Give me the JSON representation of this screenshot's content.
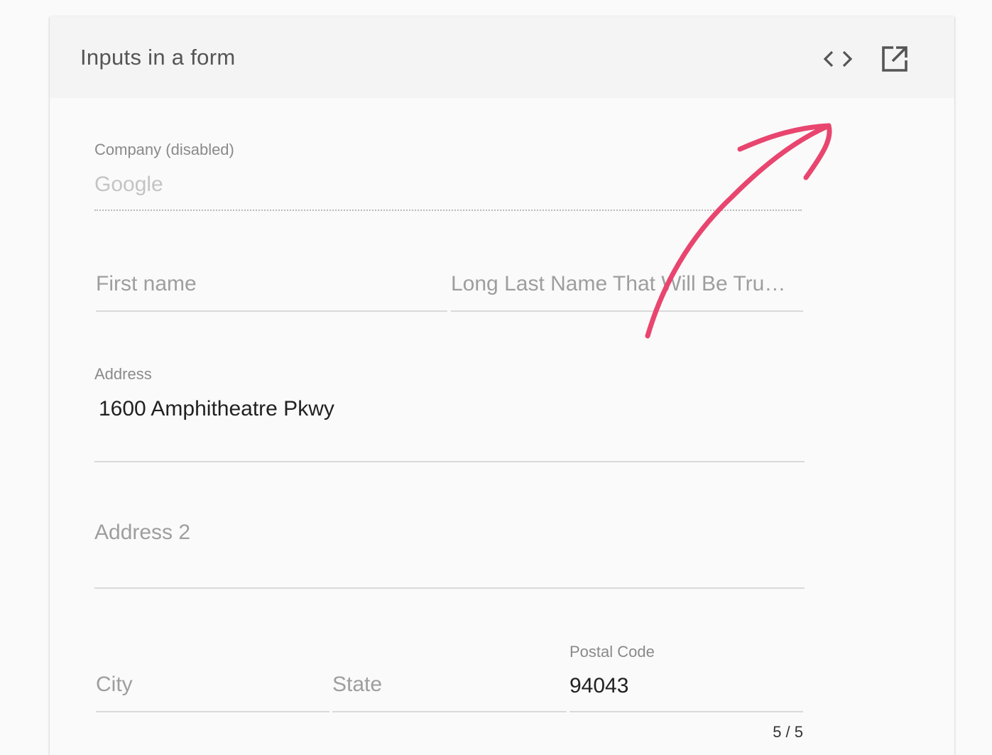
{
  "header": {
    "title": "Inputs in a form",
    "view_code_icon": "code-icon",
    "open_external_icon": "open-in-new-icon"
  },
  "form": {
    "company": {
      "label": "Company (disabled)",
      "value": "Google",
      "disabled": true
    },
    "first_name": {
      "placeholder": "First name"
    },
    "last_name": {
      "placeholder": "Long Last Name That Will Be Tru…"
    },
    "address": {
      "label": "Address",
      "value": "1600 Amphitheatre Pkwy"
    },
    "address2": {
      "placeholder": "Address 2"
    },
    "city": {
      "placeholder": "City"
    },
    "state": {
      "placeholder": "State"
    },
    "postal_code": {
      "label": "Postal Code",
      "value": "94043",
      "counter": "5 / 5"
    }
  },
  "annotation": {
    "color": "#e8456f",
    "shape": "hand-drawn-arrow"
  }
}
